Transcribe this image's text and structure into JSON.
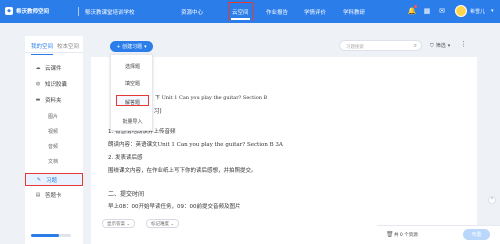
{
  "header": {
    "brand": "希沃教师空间",
    "school": "郁沃教课堂培训学校",
    "nav": [
      "资源中心",
      "云空间",
      "作业报告",
      "学情评价",
      "学科教研"
    ],
    "active_nav": "云空间",
    "icons": [
      "bell-icon",
      "apps-grid-icon",
      "chat-icon"
    ],
    "username": "希雪儿"
  },
  "sidebar": {
    "tabs": [
      "我的空间",
      "校本空间"
    ],
    "items": [
      {
        "label": "云课件",
        "icon": "cloud-icon"
      },
      {
        "label": "知识胶囊",
        "icon": "capsule-icon"
      },
      {
        "label": "资料夹",
        "icon": "folder-icon"
      },
      {
        "label": "习题",
        "icon": "exercise-icon",
        "selected": true
      },
      {
        "label": "答题卡",
        "icon": "answer-card-icon"
      }
    ],
    "sub_items": [
      "图片",
      "视频",
      "音频",
      "文档",
      "其他"
    ]
  },
  "toolbar": {
    "create_label": "+ 创建习题",
    "search_placeholder": "习题搜索",
    "filter_label": "筛选"
  },
  "dropdown": {
    "items": [
      "选择题",
      "填空题",
      "解答题",
      "批量导入"
    ],
    "highlighted": "解答题"
  },
  "content": {
    "unit_path": "下 Unit 1 Can you play the guitar? Section B",
    "task1_title": "(学习)",
    "task1_line1": "1. 有感情地朗读并上传音频",
    "task1_line2_cn": "朗读内容：英语课文",
    "task1_line2_en": "Unit 1 Can you play the guitar? Section B 3A",
    "task1_line3": "2. 发表读后感",
    "task1_line4": "围绕课文内容，在作业纸上写下你的读后感想，并拍照提交。",
    "task2_title": "二、提交时间",
    "task2_line": "早上08：00开始早读任务，09：00前提交音频及图片",
    "footer_controls": [
      "显示答案 ⌄",
      "标记难度 ⌄"
    ]
  },
  "bottom": {
    "selected_text": "共 0 个资源",
    "apply_label": "布置"
  }
}
